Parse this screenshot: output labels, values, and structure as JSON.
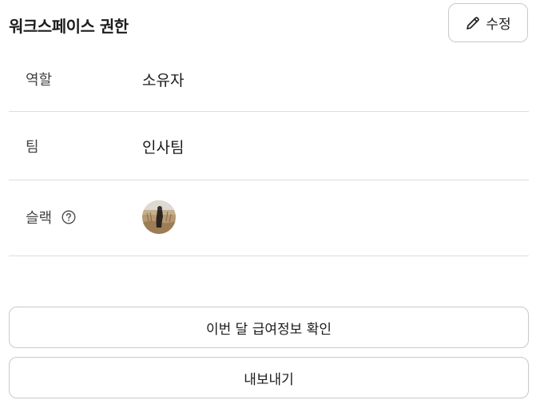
{
  "header": {
    "title": "워크스페이스 권한",
    "edit_button_label": "수정",
    "edit_icon": "pencil-icon"
  },
  "rows": [
    {
      "label": "역할",
      "value": "소유자"
    },
    {
      "label": "팀",
      "value": "인사팀"
    },
    {
      "label": "슬랙",
      "help_icon": "help-circle-icon",
      "value_type": "avatar"
    }
  ],
  "actions": {
    "salary_button_label": "이번 달 급여정보 확인",
    "export_button_label": "내보내기"
  },
  "colors": {
    "border": "#c9c9c9",
    "divider": "#dcdcdc",
    "text": "#1c1c1c",
    "label_text": "#444444"
  }
}
